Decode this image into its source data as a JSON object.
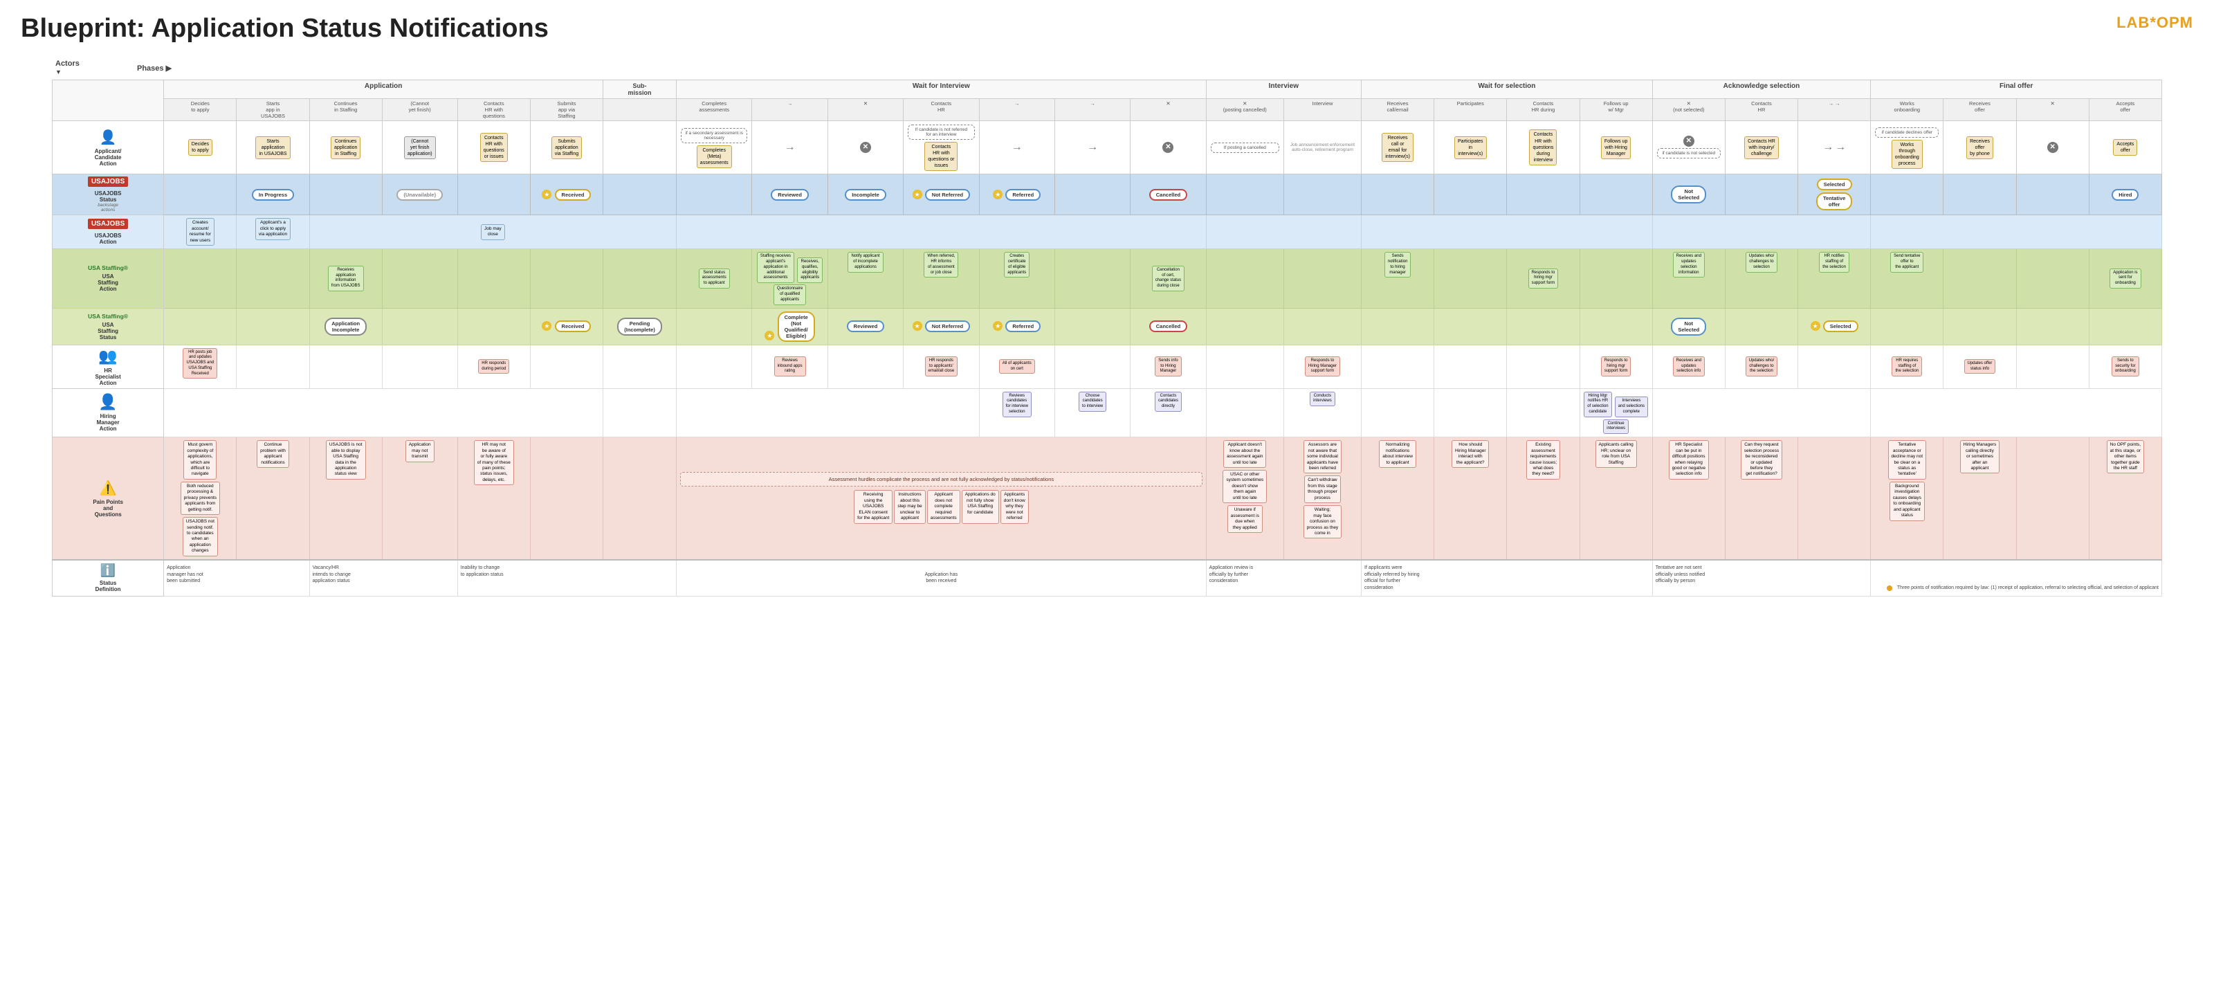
{
  "title": {
    "prefix": "Blueprint:",
    "main": "Application Status Notifications"
  },
  "logo": "LAB*OPM",
  "phases": {
    "label": "Phases ▶",
    "list": [
      {
        "id": "application",
        "label": "Application",
        "sub": ""
      },
      {
        "id": "submission",
        "label": "Sub-mission",
        "sub": ""
      },
      {
        "id": "wait-interview",
        "label": "Wait for Interview",
        "sub": ""
      },
      {
        "id": "interview",
        "label": "Interview",
        "sub": ""
      },
      {
        "id": "wait-selection",
        "label": "Wait for selection",
        "sub": ""
      },
      {
        "id": "ack-selection",
        "label": "Acknowledge selection",
        "sub": ""
      },
      {
        "id": "final-offer",
        "label": "Final offer",
        "sub": ""
      }
    ]
  },
  "actors": [
    {
      "id": "applicant",
      "label": "Applicant/ Candidate Action",
      "icon": "👤"
    },
    {
      "id": "usajobs-status",
      "label": "USAJOBS Status",
      "icon": "USAJOBS",
      "sub": "backstage actions"
    },
    {
      "id": "usajobs-action",
      "label": "USAJOBS Action",
      "icon": "USAJOBS"
    },
    {
      "id": "usa-staffing-action",
      "label": "USA Staffing Action",
      "icon": "USA Staffing"
    },
    {
      "id": "usa-staffing-status",
      "label": "USA Staffing Status",
      "icon": "USA Staffing"
    },
    {
      "id": "hr-specialist",
      "label": "HR Specialist Action",
      "icon": "👥"
    },
    {
      "id": "hiring-manager",
      "label": "Hiring Manager Action",
      "icon": "👤"
    },
    {
      "id": "pain-points",
      "label": "Pain Points and Questions",
      "icon": "⚠️"
    },
    {
      "id": "status-def",
      "label": "Status Definition",
      "icon": "ℹ️"
    }
  ],
  "statuses": {
    "usajobs": [
      "In Progress",
      "Received",
      "Reviewed",
      "Incomplete",
      "Not Referred",
      "Referred",
      "Cancelled",
      "Not Selected",
      "Selected",
      "Tentative offer",
      "Hired"
    ],
    "staffing": [
      "Application Incomplete",
      "Received",
      "Pending (Incomplete)",
      "Complete (Not Qualified/ Eligible)",
      "Reviewed",
      "Not Referred",
      "Referred",
      "Cancelled",
      "Not Selected",
      "Selected"
    ]
  },
  "applicant_actions": {
    "app_phase": [
      "Decides to apply",
      "Starts application in USAJOBS",
      "Continues application in Staffing",
      "(Cannot yet finish application)",
      "Contacts HR with questions or issues",
      "Submits application via Staffing"
    ],
    "wait_interview": [
      "Completes (Meta) assessments"
    ],
    "interview": [
      "Contacts HR with questions or issues"
    ],
    "wait_selection": [
      "Receives call or email for interview(s)",
      "Participates in interview(s)",
      "Contacts HR with questions during interview",
      "Follows up with Hiring Manager"
    ],
    "ack_selection": [
      "Contacts HR with inquiry/ challenge"
    ],
    "final_offer": [
      "Works through onboarding process",
      "Receives offer by phone",
      "Accepts offer"
    ]
  },
  "colors": {
    "usajobs_bg": "#c8ddf0",
    "usajobs_action_bg": "#daeaf8",
    "staffing_bg": "#cfe0a8",
    "staffing_action_bg": "#dce8b8",
    "pain_bg": "#f5ddd8",
    "accent_orange": "#e8a020",
    "accent_blue": "#5580c0",
    "accent_red": "#c04040"
  },
  "legend": {
    "note": "Three points of notification required by law: (1) receipt of application, referral to selecting official, and selection of applicant"
  }
}
